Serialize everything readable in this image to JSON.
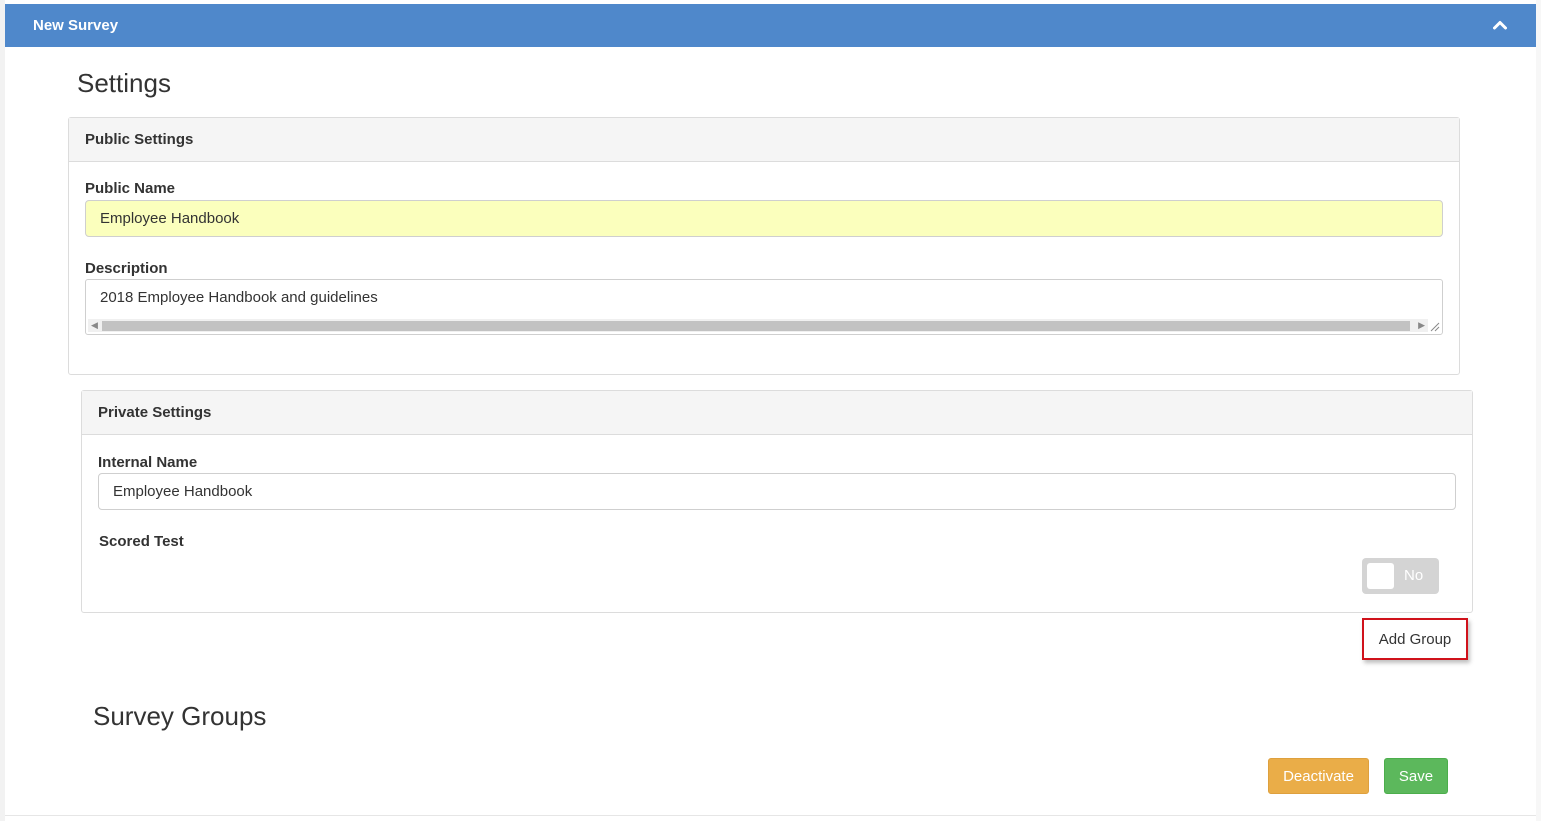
{
  "window": {
    "title": "New Survey",
    "collapse_icon": "chevron-up-icon",
    "accent_color": "#4f88cb"
  },
  "settings": {
    "heading": "Settings"
  },
  "public_settings": {
    "title": "Public Settings",
    "public_name": {
      "label": "Public Name",
      "value": "Employee Handbook"
    },
    "description": {
      "label": "Description",
      "value": "2018 Employee Handbook and guidelines"
    }
  },
  "private_settings": {
    "title": "Private Settings",
    "internal_name": {
      "label": "Internal Name",
      "value": "Employee Handbook"
    },
    "scored_test": {
      "label": "Scored Test",
      "toggle_label": "No",
      "enabled": false
    }
  },
  "add_group_label": "Add Group",
  "survey_groups": {
    "heading": "Survey Groups"
  },
  "actions": {
    "deactivate_label": "Deactivate",
    "save_label": "Save",
    "deactivate_color": "#eaad48",
    "save_color": "#5cb85c"
  }
}
